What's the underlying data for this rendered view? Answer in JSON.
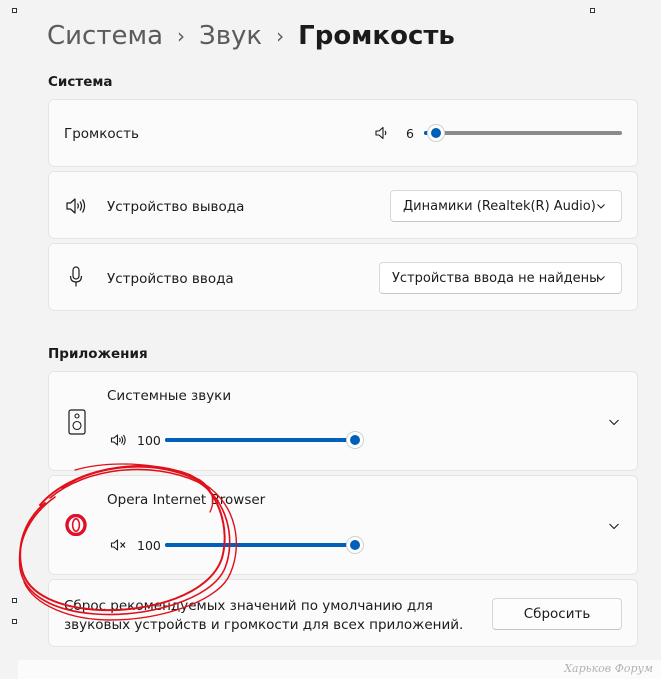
{
  "breadcrumb": {
    "items": [
      "Система",
      "Звук"
    ],
    "current": "Громкость"
  },
  "system_section": {
    "title": "Система",
    "volume": {
      "label": "Громкость",
      "value": "6",
      "level": 0.06
    },
    "output": {
      "label": "Устройство вывода",
      "selected": "Динамики (Realtek(R) Audio)"
    },
    "input": {
      "label": "Устройство ввода",
      "selected": "Устройства ввода не найдены"
    }
  },
  "apps_section": {
    "title": "Приложения",
    "apps": [
      {
        "name": "Системные звуки",
        "volume": "100",
        "level": 1.0,
        "icon": "speaker-device-icon",
        "muted": false
      },
      {
        "name": "Opera Internet Browser",
        "volume": "100",
        "level": 1.0,
        "icon": "opera-logo-icon",
        "muted": true
      }
    ]
  },
  "reset": {
    "text": "Сброс рекомендуемых значений по умолчанию для звуковых устройств и громкости для всех приложений.",
    "button": "Сбросить"
  },
  "watermark": "Харьков Форум",
  "colors": {
    "accent": "#005fb8",
    "annotation": "#e0101a",
    "background": "#f3f3f3",
    "card": "#fbfbfb"
  }
}
